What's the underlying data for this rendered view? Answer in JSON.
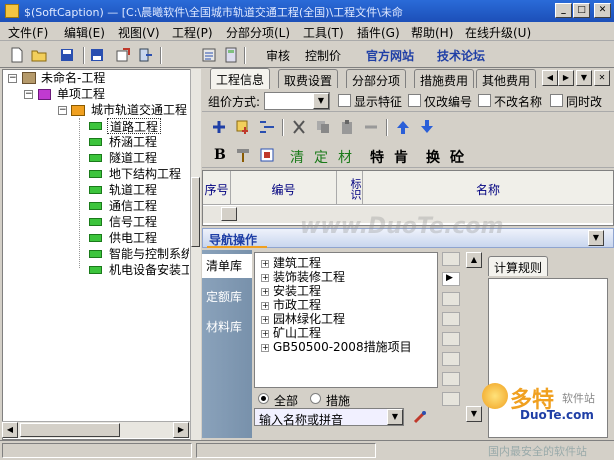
{
  "window": {
    "title": "$(SoftCaption)  —  [C:\\晨曦软件\\全国城市轨道交通工程(全国)\\工程文件\\未命"
  },
  "menu": [
    "文件(F)",
    "编辑(E)",
    "视图(V)",
    "工程(P)",
    "分部分项(L)",
    "工具(T)",
    "插件(G)",
    "帮助(H)",
    "在线升级(U)"
  ],
  "toolbar": {
    "audit": "审核",
    "control_price": "控制价",
    "official_site": "官方网站",
    "tech_forum": "技术论坛"
  },
  "tree": {
    "root": "未命名-工程",
    "single": "单项工程",
    "unit": "城市轨道交通工程",
    "leaves": [
      "道路工程",
      "桥涵工程",
      "隧道工程",
      "地下结构工程",
      "轨道工程",
      "通信工程",
      "信号工程",
      "供电工程",
      "智能与控制系统",
      "机电设备安装工"
    ]
  },
  "tabs": [
    "工程信息",
    "取费设置",
    "分部分项",
    "措施费用",
    "其他费用"
  ],
  "filters": {
    "group_label": "组价方式:",
    "show_feature": "显示特征",
    "code_only": "仅改编号",
    "keep_name": "不改名称",
    "simultaneous": "同时改"
  },
  "ops": {
    "b": "B",
    "qing": "清",
    "ding": "定",
    "cai": "材",
    "te": "特",
    "ken": "肯",
    "huan": "换",
    "jian": "砼"
  },
  "grid": {
    "cols": [
      "序号",
      "编号",
      "标识",
      "名称"
    ]
  },
  "nav": {
    "title": "导航操作",
    "left_tabs": [
      "清单库",
      "定额库",
      "材料库"
    ],
    "lib_items": [
      "建筑工程",
      "装饰装修工程",
      "安装工程",
      "市政工程",
      "园林绿化工程",
      "矿山工程",
      "GB50500-2008措施项目"
    ],
    "radio_all": "全部",
    "radio_measure": "措施",
    "search_placeholder": "输入名称或拼音",
    "calc_tab": "计算规则"
  },
  "watermark": {
    "site": "www.DuoTe.com",
    "brand": "多特",
    "brand_sub": "软件站",
    "brand_url": "DuoTe.com",
    "slogan": "国内最安全的软件站"
  },
  "colors": {
    "title_blue": "#1c4fb8",
    "leaf_green": "#3cc43c",
    "nav_tab_blue": "#7891ab"
  }
}
